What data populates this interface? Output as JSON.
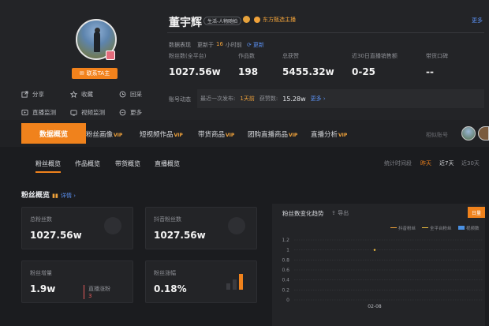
{
  "profile": {
    "name": "董宇辉",
    "tag": "生活-人物随拍",
    "anchor_label": "东方甄选主播",
    "contact_button": "联系TA主",
    "more_right": "更多"
  },
  "actions": [
    {
      "label": "分享",
      "icon": "share-icon"
    },
    {
      "label": "收藏",
      "icon": "star-icon"
    },
    {
      "label": "回采",
      "icon": "refresh-icon"
    },
    {
      "label": "直播监测",
      "icon": "live-monitor-icon"
    },
    {
      "label": "视频监测",
      "icon": "video-monitor-icon"
    },
    {
      "label": "更多",
      "icon": "more-icon"
    }
  ],
  "data_section": {
    "label": "数据表现",
    "updated_prefix": "更新于",
    "updated_value": "16",
    "updated_suffix": "小时前",
    "refresh": "更新"
  },
  "stats": [
    {
      "label": "粉丝数(全平台)",
      "value": "1027.56w"
    },
    {
      "label": "作品数",
      "value": "198"
    },
    {
      "label": "总获赞",
      "value": "5455.32w"
    },
    {
      "label": "近30日直播销售额",
      "value": "0-25"
    },
    {
      "label": "带货口碑",
      "value": "--"
    }
  ],
  "account_status": {
    "label": "账号动态",
    "last_live_prefix": "最近一次发布:",
    "last_live_value": "1天前",
    "fans_label": "获赞数:",
    "fans_value": "15.28w",
    "more": "更多"
  },
  "tabs": [
    {
      "label": "数据概览",
      "vip": "",
      "active": true
    },
    {
      "label": "粉丝画像",
      "vip": "VIP"
    },
    {
      "label": "短视频作品",
      "vip": "VIP"
    },
    {
      "label": "带货商品",
      "vip": "VIP"
    },
    {
      "label": "团购直播商品",
      "vip": "VIP"
    },
    {
      "label": "直播分析",
      "vip": "VIP"
    }
  ],
  "compare_label": "相似账号",
  "subtabs": [
    {
      "label": "粉丝概览",
      "active": true
    },
    {
      "label": "作品概览"
    },
    {
      "label": "带货概览"
    },
    {
      "label": "直播概览"
    }
  ],
  "time_range": {
    "label": "统计时间段",
    "options": [
      "昨天",
      "近7天",
      "近30天"
    ],
    "active": "昨天"
  },
  "fans_overview": {
    "title": "粉丝概览",
    "detail_link": "详情",
    "cards": [
      {
        "label": "总粉丝数",
        "value": "1027.56w"
      },
      {
        "label": "抖音粉丝数",
        "value": "1027.56w"
      },
      {
        "label": "粉丝增量",
        "value": "1.9w",
        "extra_label": "直播涨粉",
        "extra_value": "3"
      },
      {
        "label": "粉丝涨幅",
        "value": "0.18%"
      }
    ]
  },
  "chart_panel": {
    "title": "粉丝数变化趋势",
    "export": "导出",
    "button": "日量"
  },
  "chart_data": {
    "type": "line",
    "x": [
      "02-08"
    ],
    "series": [
      {
        "name": "抖音粉丝",
        "values": [
          1.0
        ]
      },
      {
        "name": "全平台粉丝",
        "values": [
          1.0
        ]
      },
      {
        "name": "视频数",
        "values": [
          0
        ]
      }
    ],
    "yticks": [
      0,
      0.2,
      0.4,
      0.6,
      0.8,
      1,
      1.2
    ],
    "ylim": [
      0,
      1.2
    ],
    "grid": true,
    "legend": "top-right"
  },
  "colors": {
    "accent": "#f0821c",
    "link": "#5a8ff0",
    "series_1": "#f2a33a",
    "series_2": "#f0c040",
    "series_3": "#4a90e2"
  }
}
